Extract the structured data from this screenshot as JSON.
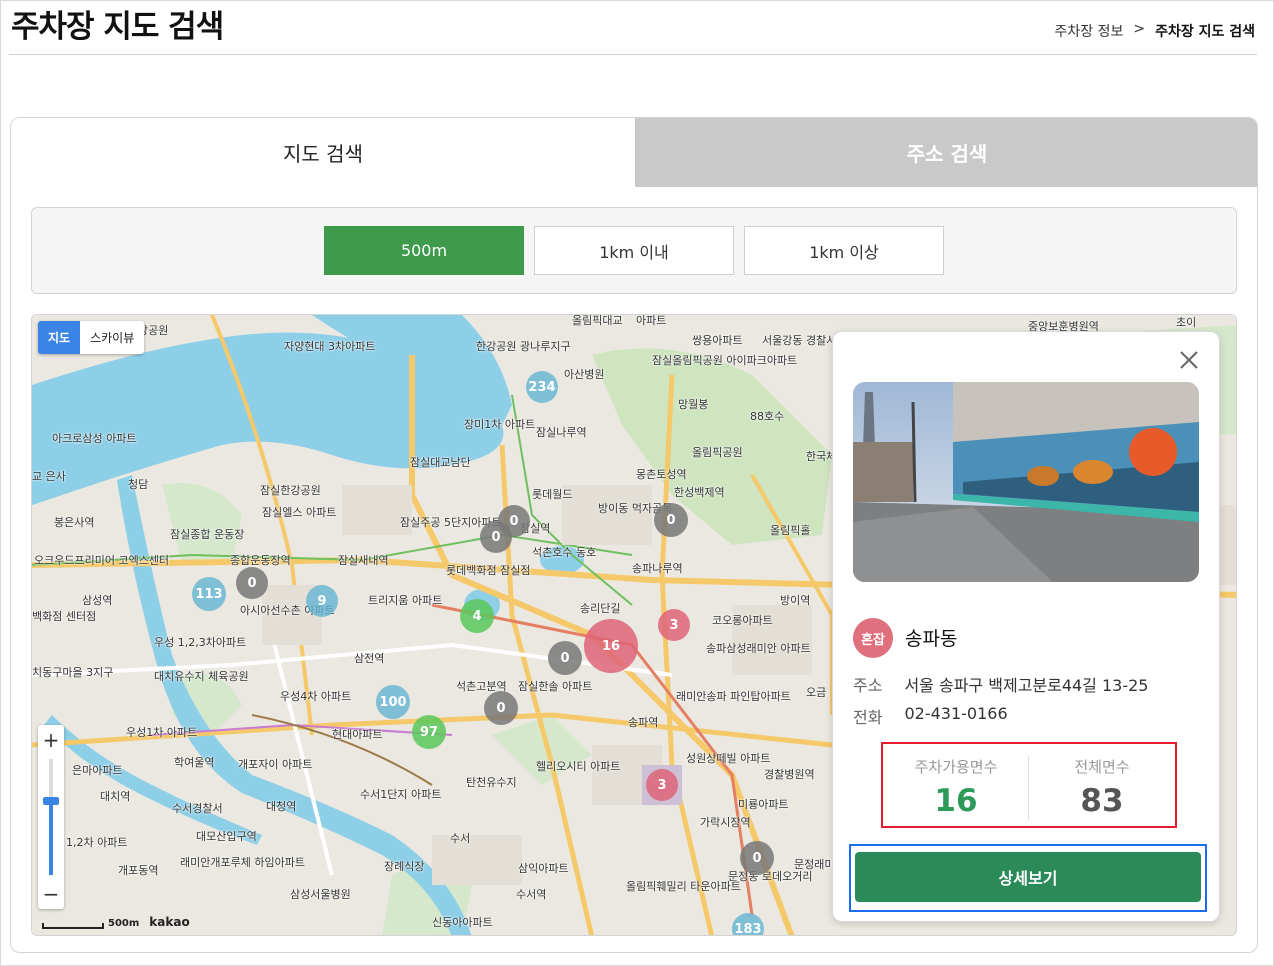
{
  "page": {
    "title": "주차장 지도 검색",
    "breadcrumb": [
      "주차장 정보",
      ">",
      "주차장 지도 검색"
    ]
  },
  "tabs": [
    {
      "label": "지도 검색",
      "active": true
    },
    {
      "label": "주소 검색",
      "active": false
    }
  ],
  "distance_filter": {
    "options": [
      "500m",
      "1km 이내",
      "1km 이상"
    ],
    "selected": "500m",
    "accent_color": "#3d9b4b"
  },
  "map": {
    "type_toggle": {
      "map": "지도",
      "skyview": "스카이뷰",
      "selected": "지도"
    },
    "zoom": {
      "in": "+",
      "out": "−"
    },
    "scale_label": "500m",
    "provider": "kakao",
    "labels": [
      "강공원",
      "자양현대 3차아파트",
      "한강공원 광나루지구",
      "올림픽대교",
      "아파트",
      "쌍용아파트",
      "서울강동 경찰서",
      "중앙보훈병원역",
      "초이",
      "아산병원",
      "잠실올림픽공원 아이파크아파트",
      "아크로삼성 아파트",
      "장미1차 아파트",
      "잠실나루역",
      "망월봉",
      "88호수",
      "잠실대교남단",
      "올림픽공원",
      "한국체 대학",
      "교 은사",
      "청담",
      "잠실한강공원",
      "롯데월드",
      "몽촌토성역",
      "한성백제역",
      "봉은사역",
      "잠실종합 운동장",
      "잠실엘스 아파트",
      "잠실주공 5단지아파트",
      "잠실역",
      "방이동 먹자골목",
      "올림픽홀",
      "오크우드프리미어 코엑스센터",
      "종합운동장역",
      "잠실새내역",
      "석촌호수 동호",
      "롯데백화점 잠실점",
      "송파나루역",
      "삼성역",
      "아시아선수촌 아파트",
      "트리지움 아파트",
      "송리단길",
      "방이역",
      "백화점 센터점",
      "우성 1,2,3차아파트",
      "삼전역",
      "코오롱아파트",
      "송파삼성래미안 아파트",
      "치동구마을 3지구",
      "대치유수지 체육공원",
      "석촌고분역",
      "잠실한솔 아파트",
      "오금",
      "우성4차 아파트",
      "래미안송파 파인탑아파트",
      "현대아파트",
      "송파역",
      "우성1차 아파트",
      "은마아파트",
      "학여울역",
      "개포자이 아파트",
      "헬리오시티 아파트",
      "탄천유수지",
      "성원상떼빌 아파트",
      "경찰병원역",
      "대치역",
      "수서경찰서",
      "대청역",
      "수서1단지 아파트",
      "미룡아파트",
      "1,2차 아파트",
      "대모산입구역",
      "가락시장역",
      "개포동역",
      "래미안개포루체 하임아파트",
      "장례식장",
      "삼익아파트",
      "문정래미 아파트",
      "수서역",
      "문정동 로데오거리",
      "삼성서울병원",
      "올림픽훼밀리 타운아파트",
      "신동아아파트",
      "수서"
    ],
    "clusters": [
      {
        "count": "234",
        "color": "blue"
      },
      {
        "count": "0",
        "color": "gray"
      },
      {
        "count": "0",
        "color": "gray"
      },
      {
        "count": "0",
        "color": "gray"
      },
      {
        "count": "113",
        "color": "blue"
      },
      {
        "count": "0",
        "color": "gray"
      },
      {
        "count": "9",
        "color": "blue"
      },
      {
        "count": "4",
        "color": "green"
      },
      {
        "count": "3",
        "color": "red"
      },
      {
        "count": "16",
        "color": "red"
      },
      {
        "count": "0",
        "color": "gray"
      },
      {
        "count": "100",
        "color": "blue"
      },
      {
        "count": "0",
        "color": "gray"
      },
      {
        "count": "97",
        "color": "green"
      },
      {
        "count": "3",
        "color": "red"
      },
      {
        "count": "0",
        "color": "gray"
      },
      {
        "count": "183",
        "color": "blue"
      }
    ]
  },
  "info_card": {
    "badge": "혼잡",
    "badge_color": "#e0707e",
    "name": "송파동",
    "address_label": "주소",
    "address": "서울 송파구 백제고분로44길 13-25",
    "phone_label": "전화",
    "phone": "02-431-0166",
    "available_label": "주차가용면수",
    "available": "16",
    "total_label": "전체면수",
    "total": "83",
    "detail_button": "상세보기",
    "highlight_red": "#e41f2d",
    "highlight_blue": "#1a6cf0"
  }
}
